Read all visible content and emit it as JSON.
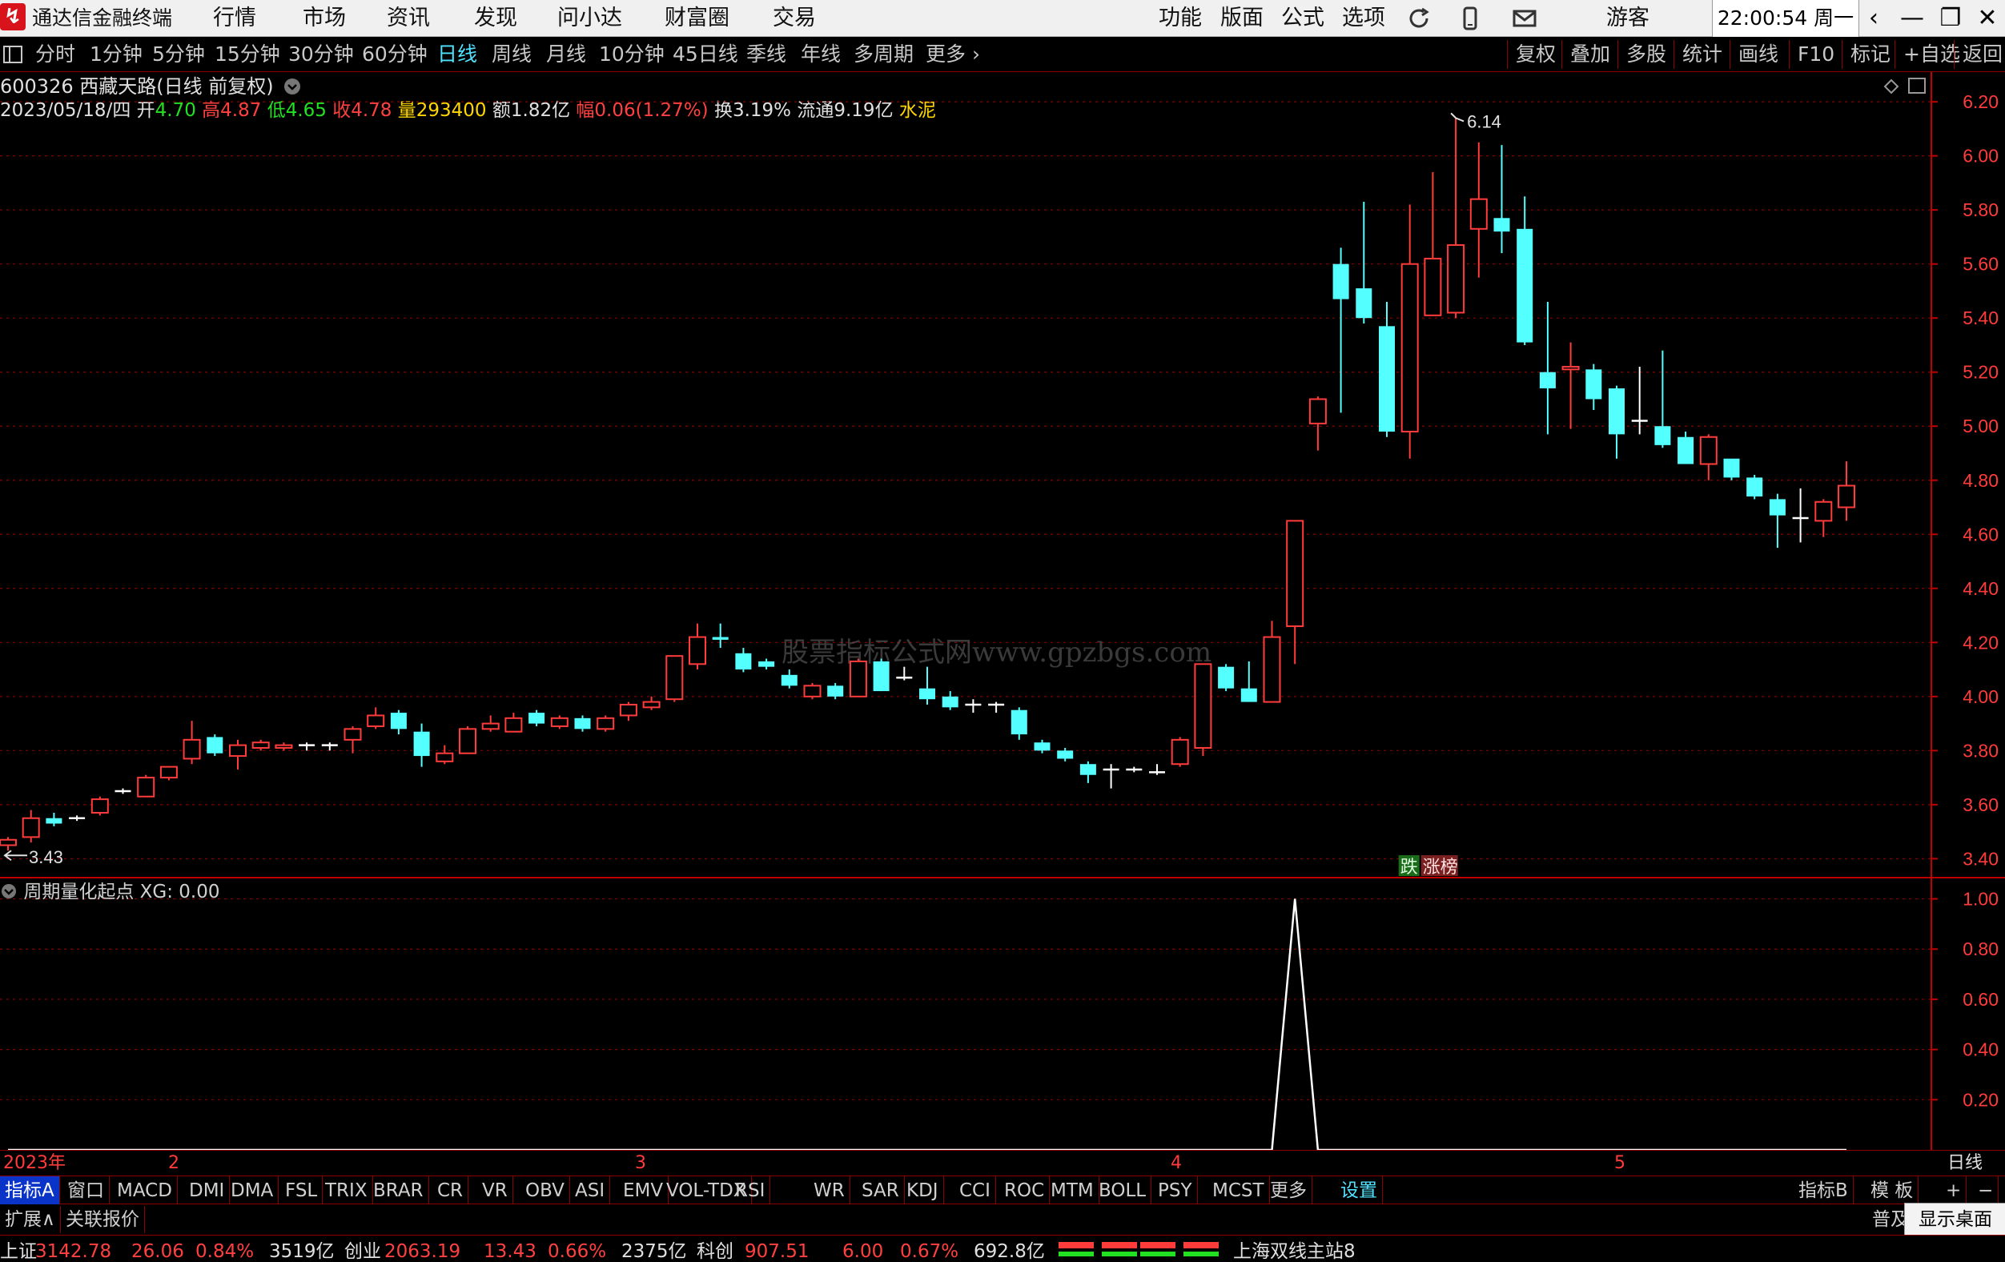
{
  "app": {
    "title": "通达信金融终端",
    "logo_glyph": "↯"
  },
  "menu": [
    "行情",
    "市场",
    "资讯",
    "发现",
    "问小达",
    "财富圈",
    "交易"
  ],
  "right_menu": [
    "功能",
    "版面",
    "公式",
    "选项"
  ],
  "user": "游客",
  "clock": "22:00:54 周一",
  "window_controls": [
    "‹",
    "—",
    "❐",
    "✕"
  ],
  "periods": [
    "分时",
    "1分钟",
    "5分钟",
    "15分钟",
    "30分钟",
    "60分钟",
    "日线",
    "周线",
    "月线",
    "10分钟",
    "45日线",
    "季线",
    "年线",
    "多周期",
    "更多 ›"
  ],
  "active_period": "日线",
  "right_tools": [
    "复权",
    "叠加",
    "多股",
    "统计",
    "画线",
    "F10",
    "标记",
    "+自选",
    "返回"
  ],
  "stock": {
    "header": "600326 西藏天路(日线 前复权)",
    "date": "2023/05/18/四",
    "open_label": "开",
    "open": "4.70",
    "high_label": "高",
    "high": "4.87",
    "low_label": "低",
    "low": "4.65",
    "close_label": "收",
    "close": "4.78",
    "vol_label": "量",
    "volume": "293400",
    "amount": "额1.82亿",
    "change": "幅0.06(1.27%)",
    "turnover": "换3.19%",
    "float_cap": "流通9.19亿",
    "sector": "水泥"
  },
  "watermark": "股票指标公式网www.gpzbgs.com",
  "badges": {
    "fall": "跌",
    "rise": "涨榜"
  },
  "annotations": {
    "high_mark": "6.14",
    "low_mark": "3.43"
  },
  "colors": {
    "up": "#ff3b3b",
    "down": "#54ffff",
    "doji": "#ffffff",
    "axis": "#c00000",
    "grid": "#8b0000",
    "active": "#4fe3ff"
  },
  "chart_data": {
    "type": "candlestick",
    "y_ticks": [
      "6.20",
      "6.00",
      "5.80",
      "5.60",
      "5.40",
      "5.20",
      "5.00",
      "4.80",
      "4.60",
      "4.40",
      "4.20",
      "4.00",
      "3.80",
      "3.60",
      "3.40"
    ],
    "ylim": [
      3.33,
      6.31
    ],
    "x_labels": [
      "2023年",
      "2",
      "3",
      "4",
      "5"
    ],
    "ohlc": [
      [
        3.45,
        3.48,
        3.43,
        3.47
      ],
      [
        3.48,
        3.58,
        3.46,
        3.55
      ],
      [
        3.55,
        3.57,
        3.52,
        3.53
      ],
      [
        3.55,
        3.56,
        3.54,
        3.55
      ],
      [
        3.57,
        3.63,
        3.56,
        3.62
      ],
      [
        3.65,
        3.66,
        3.64,
        3.65
      ],
      [
        3.63,
        3.71,
        3.63,
        3.7
      ],
      [
        3.7,
        3.74,
        3.69,
        3.74
      ],
      [
        3.77,
        3.91,
        3.75,
        3.84
      ],
      [
        3.85,
        3.86,
        3.78,
        3.79
      ],
      [
        3.78,
        3.84,
        3.73,
        3.82
      ],
      [
        3.81,
        3.84,
        3.8,
        3.83
      ],
      [
        3.81,
        3.83,
        3.8,
        3.82
      ],
      [
        3.82,
        3.83,
        3.8,
        3.82
      ],
      [
        3.82,
        3.83,
        3.8,
        3.82
      ],
      [
        3.84,
        3.89,
        3.79,
        3.88
      ],
      [
        3.89,
        3.96,
        3.88,
        3.93
      ],
      [
        3.94,
        3.95,
        3.86,
        3.88
      ],
      [
        3.87,
        3.9,
        3.74,
        3.78
      ],
      [
        3.76,
        3.82,
        3.75,
        3.79
      ],
      [
        3.79,
        3.89,
        3.79,
        3.88
      ],
      [
        3.88,
        3.93,
        3.87,
        3.9
      ],
      [
        3.87,
        3.94,
        3.87,
        3.92
      ],
      [
        3.94,
        3.95,
        3.89,
        3.9
      ],
      [
        3.89,
        3.93,
        3.88,
        3.92
      ],
      [
        3.92,
        3.93,
        3.87,
        3.88
      ],
      [
        3.88,
        3.93,
        3.87,
        3.92
      ],
      [
        3.93,
        3.98,
        3.91,
        3.97
      ],
      [
        3.96,
        4.0,
        3.95,
        3.98
      ],
      [
        3.99,
        4.13,
        3.98,
        4.15
      ],
      [
        4.12,
        4.27,
        4.1,
        4.22
      ],
      [
        4.22,
        4.27,
        4.18,
        4.21
      ],
      [
        4.16,
        4.18,
        4.09,
        4.1
      ],
      [
        4.13,
        4.14,
        4.1,
        4.11
      ],
      [
        4.08,
        4.1,
        4.03,
        4.04
      ],
      [
        4.0,
        4.05,
        3.99,
        4.04
      ],
      [
        4.04,
        4.05,
        3.99,
        4.0
      ],
      [
        4.0,
        4.14,
        4.0,
        4.13
      ],
      [
        4.13,
        4.14,
        4.02,
        4.02
      ],
      [
        4.07,
        4.11,
        4.06,
        4.07
      ],
      [
        4.03,
        4.11,
        3.97,
        3.99
      ],
      [
        4.0,
        4.02,
        3.95,
        3.96
      ],
      [
        3.97,
        3.99,
        3.94,
        3.97
      ],
      [
        3.97,
        3.98,
        3.94,
        3.97
      ],
      [
        3.95,
        3.96,
        3.84,
        3.86
      ],
      [
        3.83,
        3.84,
        3.79,
        3.8
      ],
      [
        3.8,
        3.81,
        3.76,
        3.77
      ],
      [
        3.75,
        3.76,
        3.68,
        3.71
      ],
      [
        3.73,
        3.75,
        3.66,
        3.73
      ],
      [
        3.73,
        3.74,
        3.72,
        3.73
      ],
      [
        3.72,
        3.75,
        3.71,
        3.72
      ],
      [
        3.75,
        3.85,
        3.74,
        3.84
      ],
      [
        3.81,
        4.12,
        3.78,
        4.12
      ],
      [
        4.11,
        4.12,
        4.02,
        4.03
      ],
      [
        4.03,
        4.13,
        3.98,
        3.98
      ],
      [
        3.98,
        4.28,
        3.98,
        4.22
      ],
      [
        4.26,
        4.65,
        4.12,
        4.65
      ],
      [
        5.01,
        5.11,
        4.91,
        5.1
      ],
      [
        5.6,
        5.66,
        5.05,
        5.47
      ],
      [
        5.51,
        5.83,
        5.38,
        5.4
      ],
      [
        5.37,
        5.46,
        4.96,
        4.98
      ],
      [
        4.98,
        5.82,
        4.88,
        5.6
      ],
      [
        5.41,
        5.94,
        5.41,
        5.62
      ],
      [
        5.42,
        6.14,
        5.4,
        5.67
      ],
      [
        5.73,
        6.05,
        5.55,
        5.84
      ],
      [
        5.77,
        6.04,
        5.64,
        5.72
      ],
      [
        5.73,
        5.85,
        5.3,
        5.31
      ],
      [
        5.2,
        5.46,
        4.97,
        5.14
      ],
      [
        5.21,
        5.31,
        4.99,
        5.22
      ],
      [
        5.21,
        5.23,
        5.06,
        5.1
      ],
      [
        5.14,
        5.15,
        4.88,
        4.97
      ],
      [
        5.02,
        5.22,
        4.97,
        5.02
      ],
      [
        5.0,
        5.28,
        4.92,
        4.93
      ],
      [
        4.96,
        4.98,
        4.88,
        4.86
      ],
      [
        4.86,
        4.97,
        4.8,
        4.96
      ],
      [
        4.88,
        4.87,
        4.8,
        4.81
      ],
      [
        4.81,
        4.82,
        4.73,
        4.74
      ],
      [
        4.73,
        4.75,
        4.55,
        4.67
      ],
      [
        4.66,
        4.77,
        4.57,
        4.66
      ],
      [
        4.65,
        4.73,
        4.59,
        4.72
      ],
      [
        4.7,
        4.87,
        4.65,
        4.78
      ]
    ],
    "indicator": {
      "name": "周期量化起点",
      "series_label": "XG: 0.00",
      "y_ticks": [
        "1.00",
        "0.80",
        "0.60",
        "0.40",
        "0.20"
      ],
      "ylim": [
        0,
        1.04
      ],
      "signal_index": 56,
      "signal_value": 1.0,
      "baseline": 0.0
    }
  },
  "x_period_label": "日线",
  "indicator_tabs": [
    "指标A",
    "窗口",
    "MACD",
    "DMI",
    "DMA",
    "FSL",
    "TRIX",
    "BRAR",
    "CR",
    "VR",
    "OBV",
    "ASI",
    "EMV",
    "VOL-TDX",
    "RSI",
    "WR",
    "SAR",
    "KDJ",
    "CCI",
    "ROC",
    "MTM",
    "BOLL",
    "PSY",
    "MCST",
    "更多",
    "设置"
  ],
  "indicator_right": [
    "指标B",
    "模 板",
    "+",
    "−"
  ],
  "ext_tabs": [
    "扩展∧",
    "关联报价"
  ],
  "ext_right": "普及",
  "show_desktop": "显示桌面",
  "status": {
    "sh_label": "上证",
    "sh_val": "3142.78",
    "sh_chg": "26.06",
    "sh_pct": "0.84%",
    "sh_amt": "3519亿",
    "cy_label": "创业",
    "cy_val": "2063.19",
    "cy_chg": "13.43",
    "cy_pct": "0.66%",
    "cy_amt": "2375亿",
    "kc_label": "科创",
    "kc_val": "907.51",
    "kc_chg": "6.00",
    "kc_pct": "0.67%",
    "kc_amt": "692.8亿",
    "server": "上海双线主站8"
  }
}
